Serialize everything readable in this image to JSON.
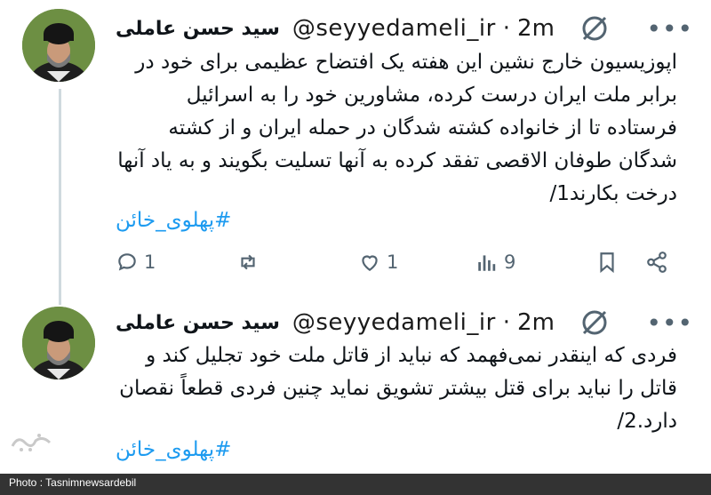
{
  "tweets": [
    {
      "author": {
        "name": "سید حسن عاملی",
        "handle": "@seyyedameli_ir",
        "time": "2m",
        "separator": "·"
      },
      "text": "اپوزیسیون خارج نشین این هفته یک افتضاح عظیمی برای خود در برابر ملت ایران درست کرده، مشاورین خود را به اسرائیل فرستاده تا از خانواده کشته شدگان در حمله ایران و از کشته شدگان طوفان الاقصی تفقد کرده به آنها تسلیت بگویند و به یاد آنها درخت بکارند1/",
      "hashtag": "#پهلوی_خائن",
      "actions": {
        "reply_count": "1",
        "retweet_count": "",
        "like_count": "1",
        "view_count": "9"
      }
    },
    {
      "author": {
        "name": "سید حسن عاملی",
        "handle": "@seyyedameli_ir",
        "time": "2m",
        "separator": "·"
      },
      "text": "فردی که اینقدر نمی‌فهمد که نباید از قاتل ملت خود تجلیل کند و قاتل را نباید برای قتل بیشتر تشویق نماید چنین فردی قطعاً نقصان دارد.2/",
      "hashtag": "#پهلوی_خائن"
    }
  ],
  "icons": {
    "grok": "grok-slash-circle-icon",
    "more": "more-dots-icon",
    "reply": "reply-icon",
    "retweet": "retweet-icon",
    "like": "heart-icon",
    "views": "views-icon",
    "bookmark": "bookmark-icon",
    "share": "share-icon"
  },
  "footer": {
    "credit": "Photo : Tasnimnewsardebil"
  },
  "colors": {
    "hashtag": "#1d9bf0",
    "muted": "#536471",
    "footer_bg": "#333333"
  }
}
